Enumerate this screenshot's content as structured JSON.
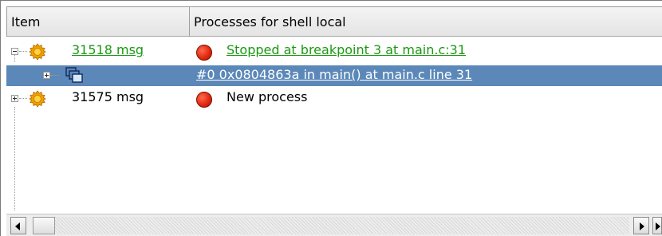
{
  "header": {
    "col_item": "Item",
    "col_processes": "Processes for shell local"
  },
  "rows": [
    {
      "item": "31518 msg",
      "status": "Stopped at breakpoint 3 at main.c:31",
      "icon": "gear-icon",
      "status_icon": "red-dot-icon",
      "expanded": true
    },
    {
      "item": "",
      "status": "#0 0x0804863a in main() at main.c line 31",
      "icon": "windows-icon",
      "selected": true
    },
    {
      "item": "31575 msg",
      "status": "New process",
      "icon": "gear-icon",
      "status_icon": "red-dot-icon",
      "expanded": false
    }
  ],
  "colors": {
    "link": "#1a9a12",
    "selection": "#5b88b8"
  }
}
